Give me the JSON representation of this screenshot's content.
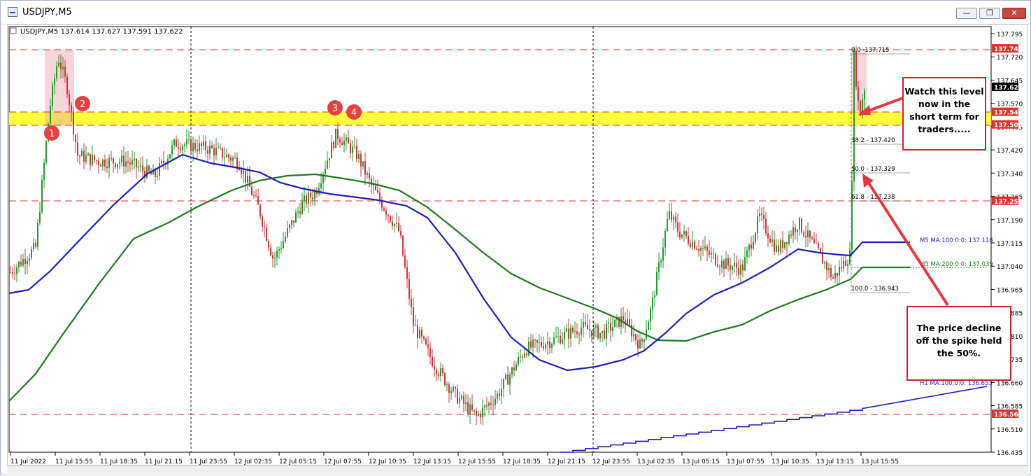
{
  "window": {
    "title": "USDJPY,M5",
    "minimize": "—",
    "restore": "❐",
    "close": "✕"
  },
  "chart": {
    "header": "USDJPY,M5  137.614 137.627 137.591 137.622"
  },
  "price_axis": {
    "ticks": [
      "137.795",
      "137.720",
      "137.645",
      "137.570",
      "137.495",
      "137.420",
      "137.340",
      "137.265",
      "137.190",
      "137.115",
      "137.040",
      "136.965",
      "136.885",
      "136.810",
      "136.735",
      "136.660",
      "136.585",
      "136.510",
      "136.435"
    ]
  },
  "price_tags": [
    {
      "label": "137.747",
      "kind": "red"
    },
    {
      "label": "137.622",
      "kind": "black"
    },
    {
      "label": "137.541",
      "kind": "red"
    },
    {
      "label": "137.500",
      "kind": "red"
    },
    {
      "label": "137.252",
      "kind": "red"
    },
    {
      "label": "136.560",
      "kind": "red"
    }
  ],
  "time_axis": {
    "ticks": [
      "11 Jul 2022",
      "11 Jul 15:55",
      "11 Jul 18:35",
      "11 Jul 21:15",
      "11 Jul 23:55",
      "12 Jul 02:35",
      "12 Jul 05:15",
      "12 Jul 07:55",
      "12 Jul 10:35",
      "12 Jul 13:15",
      "12 Jul 15:55",
      "12 Jul 18:35",
      "12 Jul 21:15",
      "12 Jul 23:55",
      "13 Jul 02:35",
      "13 Jul 05:15",
      "13 Jul 07:55",
      "13 Jul 10:35",
      "13 Jul 13:15",
      "13 Jul 15:55"
    ]
  },
  "fibonacci": {
    "levels": [
      "0.0 -137.715",
      "38.2 - 137.420",
      "50.0 - 137.329",
      "61.8 - 137.238",
      "100.0 - 136.943"
    ]
  },
  "indicators": {
    "ma100": "M5 MA:100:0:0: 137.118",
    "ma200": "M5 MA:200:0:0: 137.039",
    "h1ma100": "H1 MA:100:0:0: 136.653",
    "colors": {
      "ma100": "#1f1fb8",
      "ma200": "#1e7a1e",
      "h1ma100": "#1f1fb8"
    }
  },
  "markers": [
    "1",
    "2",
    "3",
    "4"
  ],
  "annotations": {
    "watch": "Watch this level now in the short term for traders.....",
    "held": "The price decline off the spike held the 50%."
  },
  "colors": {
    "bull": "#1f9e2a",
    "bear": "#d9323b",
    "band": "#ffff33",
    "level": "#e03030",
    "marker": "#e84040"
  }
}
